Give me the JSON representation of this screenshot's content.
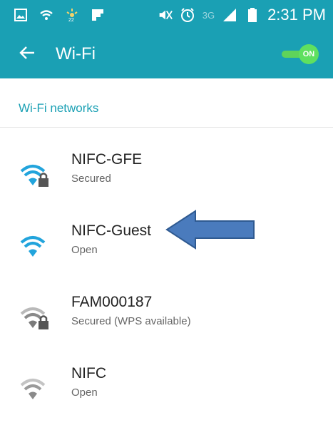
{
  "status_bar": {
    "network_label": "3G",
    "time": "2:31 PM",
    "icons": [
      "gallery-icon",
      "wifi-icon",
      "weather-icon",
      "flipboard-icon",
      "mute-icon",
      "alarm-icon",
      "signal-icon",
      "battery-icon"
    ]
  },
  "app_bar": {
    "title": "Wi-Fi",
    "toggle_label": "ON",
    "accent_color": "#1aa0b4",
    "toggle_color": "#5fe05f"
  },
  "section": {
    "header": "Wi-Fi networks"
  },
  "networks": [
    {
      "name": "NIFC-GFE",
      "status": "Secured",
      "locked": true,
      "signal": "strong"
    },
    {
      "name": "NIFC-Guest",
      "status": "Open",
      "locked": false,
      "signal": "strong"
    },
    {
      "name": "FAM000187",
      "status": "Secured (WPS available)",
      "locked": true,
      "signal": "weak"
    },
    {
      "name": "NIFC",
      "status": "Open",
      "locked": false,
      "signal": "weak"
    }
  ],
  "annotation": {
    "arrow_color": "#4a7bbd",
    "target": "NIFC-Guest"
  }
}
